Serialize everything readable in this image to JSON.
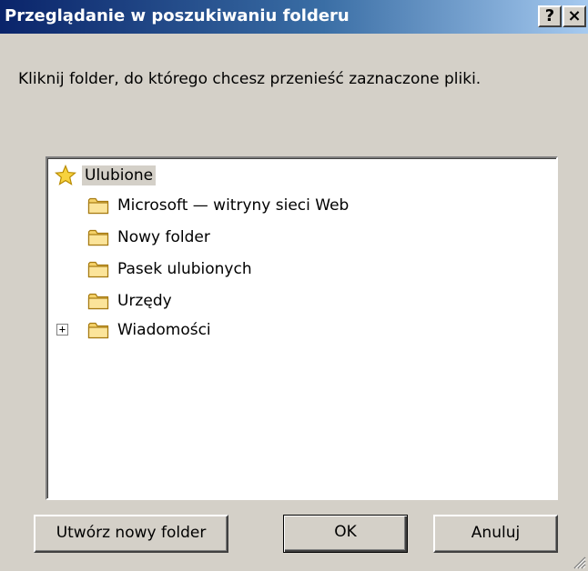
{
  "window": {
    "title": "Przeglądanie w poszukiwaniu folderu",
    "help_label": "?",
    "close_label": "×"
  },
  "instruction": "Kliknij folder, do którego chcesz przenieść zaznaczone pliki.",
  "tree": {
    "root": {
      "label": "Ulubione",
      "icon": "star-icon",
      "selected": true
    },
    "items": [
      {
        "label": "Microsoft — witryny sieci Web",
        "icon": "folder-icon"
      },
      {
        "label": "Nowy folder",
        "icon": "folder-icon"
      },
      {
        "label": "Pasek ulubionych",
        "icon": "folder-icon"
      },
      {
        "label": "Urzędy",
        "icon": "folder-icon"
      },
      {
        "label": "Wiadomości",
        "icon": "folder-icon",
        "expandable": true,
        "expander": "+"
      }
    ]
  },
  "buttons": {
    "new_folder": "Utwórz nowy folder",
    "ok": "OK",
    "cancel": "Anuluj"
  }
}
